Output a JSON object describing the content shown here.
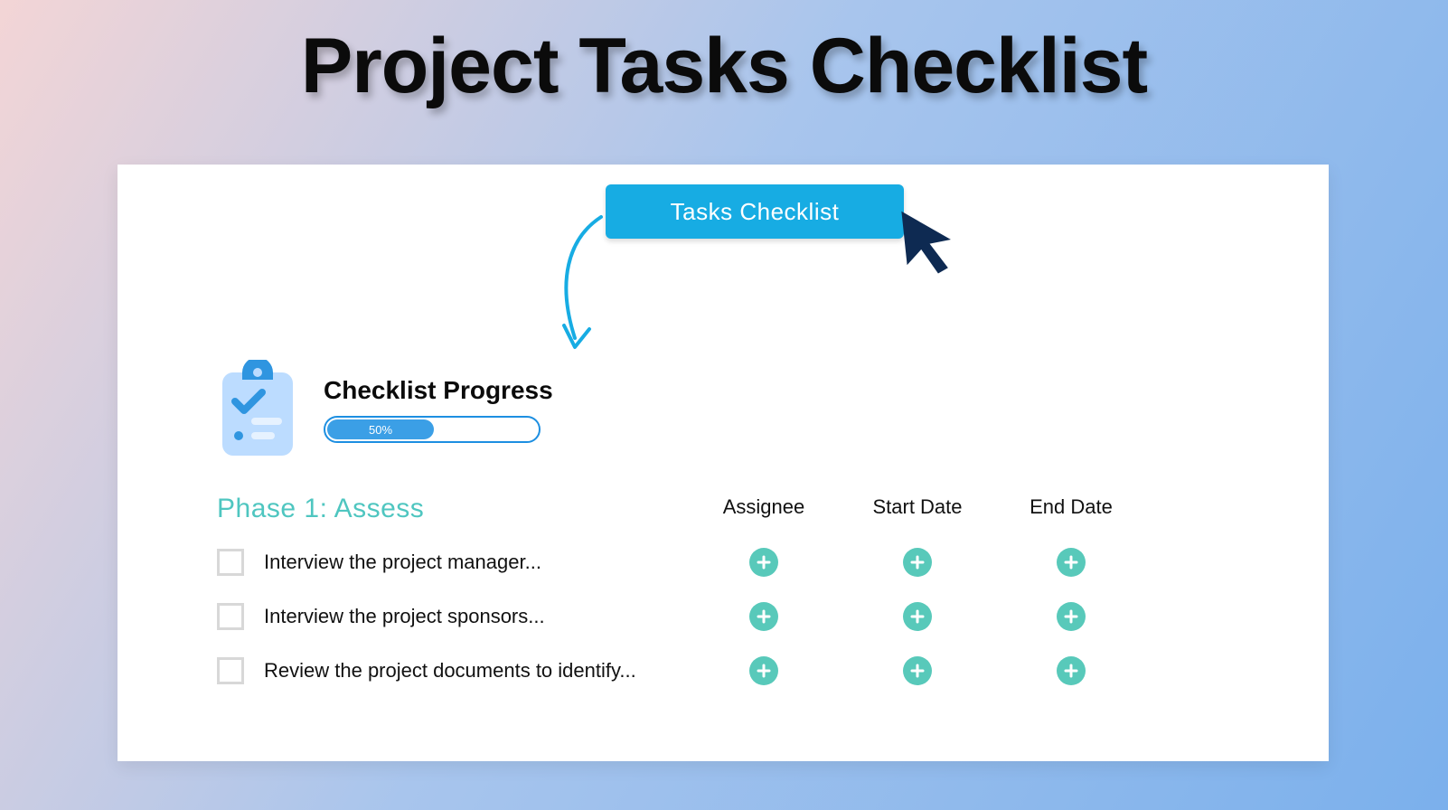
{
  "page": {
    "title": "Project Tasks Checklist"
  },
  "button": {
    "tasks_checklist": "Tasks Checklist"
  },
  "progress": {
    "title": "Checklist Progress",
    "percent_label": "50%",
    "percent_value": 50
  },
  "phase": {
    "title": "Phase 1: Assess"
  },
  "columns": {
    "assignee": "Assignee",
    "start_date": "Start Date",
    "end_date": "End Date"
  },
  "tasks": [
    {
      "label": "Interview the project manager..."
    },
    {
      "label": "Interview the project sponsors..."
    },
    {
      "label": "Review the project documents to identify..."
    }
  ],
  "icons": {
    "cursor": "cursor-icon",
    "arrow": "curved-arrow-icon",
    "clipboard": "clipboard-check-icon",
    "plus": "plus-icon"
  },
  "colors": {
    "accent_blue": "#17ace3",
    "progress_blue": "#3b9fe6",
    "teal": "#58c9ba",
    "phase_teal": "#4fc6c0",
    "navy": "#0e2a52"
  }
}
